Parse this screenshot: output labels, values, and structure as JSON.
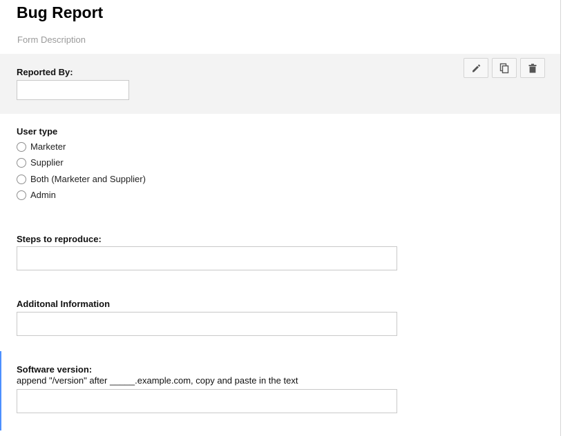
{
  "form": {
    "title": "Bug Report",
    "description_placeholder": "Form Description"
  },
  "toolbar": {
    "edit_icon": "pencil-icon",
    "duplicate_icon": "duplicate-icon",
    "delete_icon": "trash-icon"
  },
  "questions": {
    "reported_by": {
      "label": "Reported By:",
      "value": ""
    },
    "user_type": {
      "label": "User type",
      "options": [
        "Marketer",
        "Supplier",
        "Both (Marketer and Supplier)",
        "Admin"
      ]
    },
    "steps": {
      "label": "Steps to reproduce:",
      "value": ""
    },
    "additional": {
      "label": "Additonal Information",
      "value": ""
    },
    "software_version": {
      "label": "Software version:",
      "help": "append \"/version\" after _____.example.com, copy and paste in the text",
      "value": ""
    }
  },
  "colors": {
    "active_question_bg": "#f3f3f3",
    "focus_accent": "#4d90fe",
    "description_text": "#9a9a9a"
  }
}
